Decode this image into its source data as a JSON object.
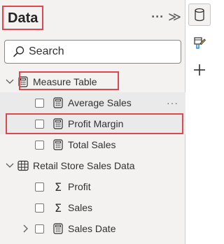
{
  "pane": {
    "title": "Data",
    "more_glyph": "···",
    "collapse_glyph": "≫"
  },
  "search": {
    "placeholder": "Search"
  },
  "tables": [
    {
      "name": "Measure Table",
      "fields": [
        {
          "name": "Average Sales",
          "type": "measure"
        },
        {
          "name": "Profit Margin",
          "type": "measure"
        },
        {
          "name": "Total Sales",
          "type": "measure"
        }
      ]
    },
    {
      "name": "Retail Store Sales Data",
      "fields": [
        {
          "name": "Profit",
          "type": "sum"
        },
        {
          "name": "Sales",
          "type": "sum"
        },
        {
          "name": "Sales Date",
          "type": "measure"
        }
      ]
    }
  ],
  "row_more_glyph": "···",
  "sigma_glyph": "Σ",
  "colors": {
    "highlight": "#e0474c",
    "pane_bg": "#f3f2f1"
  }
}
